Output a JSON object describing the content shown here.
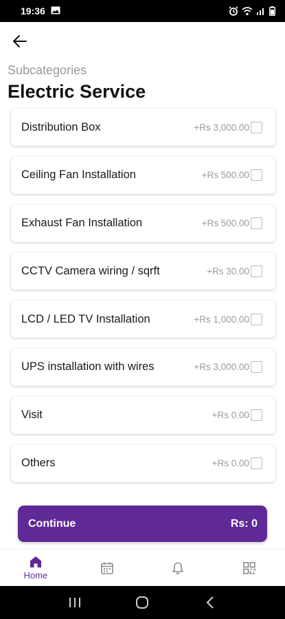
{
  "status_bar": {
    "time": "19:36"
  },
  "header": {
    "subtitle": "Subcategories",
    "title": "Electric Service"
  },
  "items": [
    {
      "label": "Distribution Box",
      "price": "+Rs 3,000.00"
    },
    {
      "label": "Ceiling Fan Installation",
      "price": "+Rs 500.00"
    },
    {
      "label": "Exhaust Fan Installation",
      "price": "+Rs 500.00"
    },
    {
      "label": "CCTV Camera wiring / sqrft",
      "price": "+Rs 30.00"
    },
    {
      "label": "LCD / LED TV Installation",
      "price": "+Rs 1,000.00"
    },
    {
      "label": "UPS installation with wires",
      "price": "+Rs 3,000.00"
    },
    {
      "label": "Visit",
      "price": "+Rs 0.00"
    },
    {
      "label": "Others",
      "price": "+Rs 0.00"
    }
  ],
  "continue_bar": {
    "label": "Continue",
    "total": "Rs: 0"
  },
  "bottom_nav": {
    "home_label": "Home"
  },
  "colors": {
    "accent": "#5f2a98",
    "muted_text": "#9a9a9a"
  }
}
